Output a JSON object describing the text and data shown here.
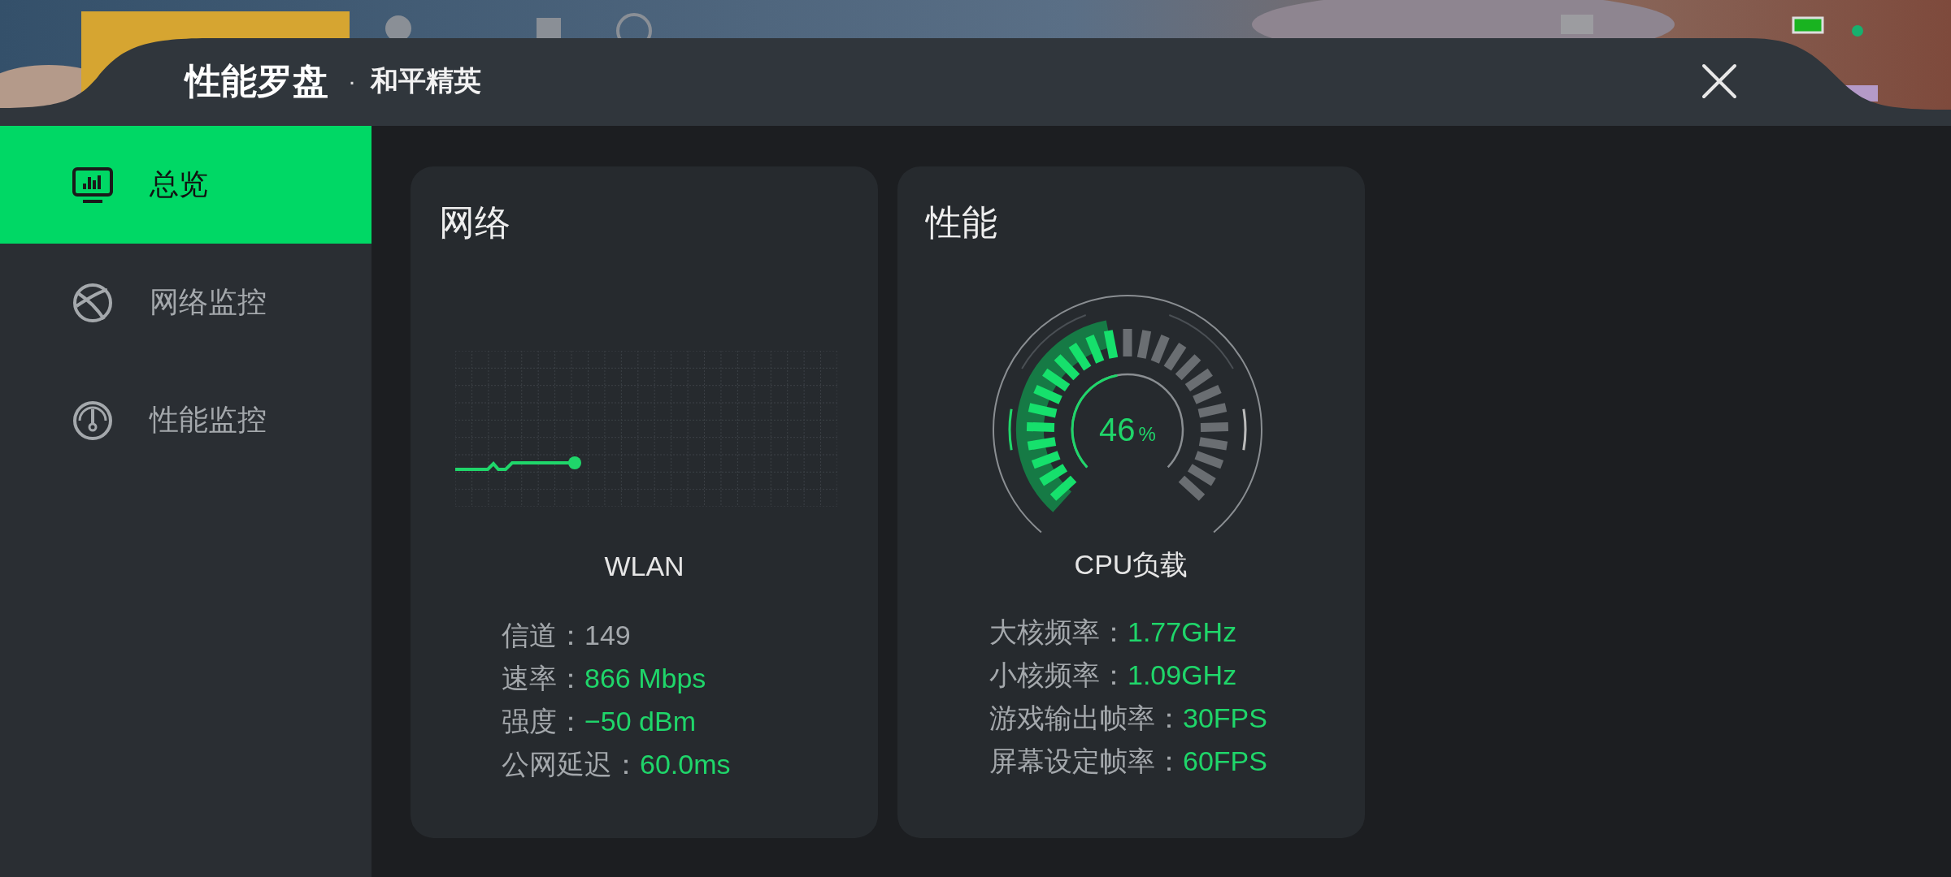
{
  "window": {
    "title": "性能罗盘",
    "separator": "·",
    "subtitle": "和平精英"
  },
  "sidebar": {
    "items": [
      {
        "label": "总览",
        "selected": true
      },
      {
        "label": "网络监控",
        "selected": false
      },
      {
        "label": "性能监控",
        "selected": false
      }
    ]
  },
  "cards": [
    {
      "kind": "network",
      "title": "网络",
      "caption": "WLAN",
      "stats": [
        {
          "label": "信道：",
          "value": "149",
          "highlight": false
        },
        {
          "label": "速率：",
          "value": "866 Mbps",
          "highlight": true
        },
        {
          "label": "强度：",
          "value": "−50 dBm",
          "highlight": true
        },
        {
          "label": "公网延迟：",
          "value": "60.0ms",
          "highlight": true
        }
      ]
    },
    {
      "kind": "performance",
      "title": "性能",
      "gauge": {
        "reading": "46",
        "unit": "%"
      },
      "caption": "CPU负载",
      "stats": [
        {
          "label": "大核频率：",
          "value": "1.77GHz",
          "highlight": true
        },
        {
          "label": "小核频率：",
          "value": "1.09GHz",
          "highlight": true
        },
        {
          "label": "游戏输出帧率：",
          "value": "30FPS",
          "highlight": true
        },
        {
          "label": "屏幕设定帧率：",
          "value": "60FPS",
          "highlight": true
        }
      ]
    }
  ]
}
